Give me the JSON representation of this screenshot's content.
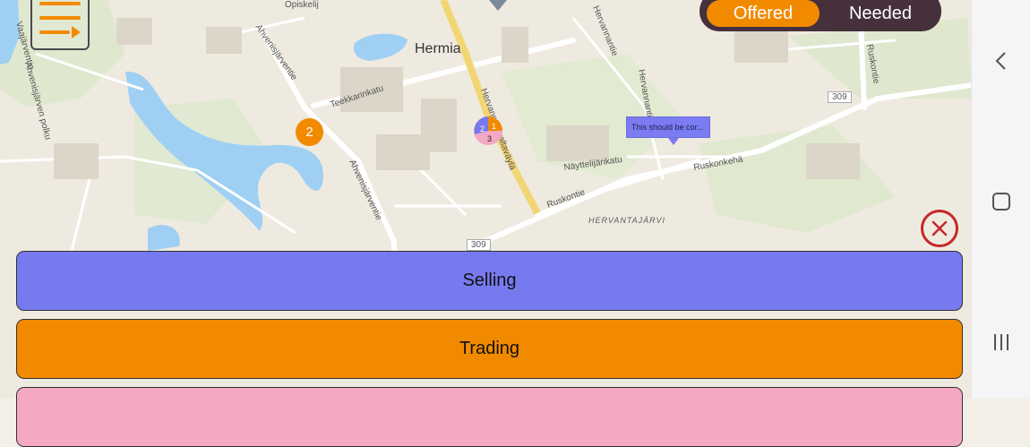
{
  "map": {
    "place_label": "Hermia",
    "road_number_a": "309",
    "road_number_b": "309",
    "area_label": "HERVANTAJÄRVI",
    "cluster_marker_count": "2",
    "pie_marker_counts": [
      "2",
      "1",
      "3"
    ],
    "tooltip_text": "This should be cor...",
    "street_labels": [
      "Opiskelij",
      "Ahvenisjärventie",
      "Teekkarinkatu",
      "Hervannan valtaväylä",
      "Näyttelijänkatu",
      "Ruskonkehä",
      "Ruskontie",
      "Ahvenisjärventie",
      "Hervannantie",
      "Ruskontie",
      "Vaajärventie",
      "Ahvenisjärven polku",
      "Herwanta"
    ]
  },
  "toggle": {
    "offered_label": "Offered",
    "needed_label": "Needed"
  },
  "buttons": {
    "selling_label": "Selling",
    "trading_label": "Trading"
  },
  "colors": {
    "selling": "#7779ef",
    "trading": "#f28a00",
    "third": "#f4a8c4",
    "toggle_bg": "#45303b",
    "close": "#c62828"
  },
  "icons": {
    "menu": "filter-list-icon",
    "close": "close-circle-icon",
    "back": "chevron-left-icon",
    "home": "square-icon",
    "recent": "recents-icon"
  }
}
